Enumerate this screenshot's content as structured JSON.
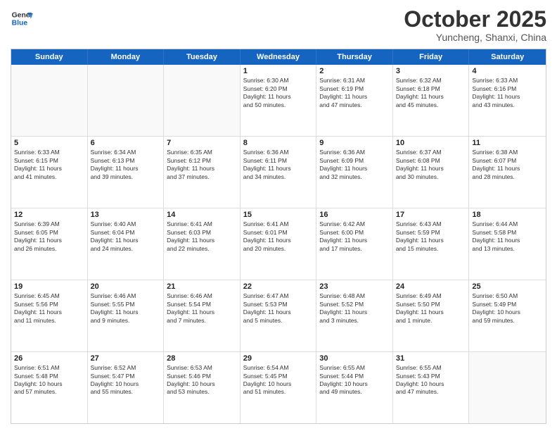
{
  "logo": {
    "line1": "General",
    "line2": "Blue"
  },
  "title": "October 2025",
  "subtitle": "Yuncheng, Shanxi, China",
  "weekdays": [
    "Sunday",
    "Monday",
    "Tuesday",
    "Wednesday",
    "Thursday",
    "Friday",
    "Saturday"
  ],
  "weeks": [
    [
      {
        "day": "",
        "info": ""
      },
      {
        "day": "",
        "info": ""
      },
      {
        "day": "",
        "info": ""
      },
      {
        "day": "1",
        "info": "Sunrise: 6:30 AM\nSunset: 6:20 PM\nDaylight: 11 hours\nand 50 minutes."
      },
      {
        "day": "2",
        "info": "Sunrise: 6:31 AM\nSunset: 6:19 PM\nDaylight: 11 hours\nand 47 minutes."
      },
      {
        "day": "3",
        "info": "Sunrise: 6:32 AM\nSunset: 6:18 PM\nDaylight: 11 hours\nand 45 minutes."
      },
      {
        "day": "4",
        "info": "Sunrise: 6:33 AM\nSunset: 6:16 PM\nDaylight: 11 hours\nand 43 minutes."
      }
    ],
    [
      {
        "day": "5",
        "info": "Sunrise: 6:33 AM\nSunset: 6:15 PM\nDaylight: 11 hours\nand 41 minutes."
      },
      {
        "day": "6",
        "info": "Sunrise: 6:34 AM\nSunset: 6:13 PM\nDaylight: 11 hours\nand 39 minutes."
      },
      {
        "day": "7",
        "info": "Sunrise: 6:35 AM\nSunset: 6:12 PM\nDaylight: 11 hours\nand 37 minutes."
      },
      {
        "day": "8",
        "info": "Sunrise: 6:36 AM\nSunset: 6:11 PM\nDaylight: 11 hours\nand 34 minutes."
      },
      {
        "day": "9",
        "info": "Sunrise: 6:36 AM\nSunset: 6:09 PM\nDaylight: 11 hours\nand 32 minutes."
      },
      {
        "day": "10",
        "info": "Sunrise: 6:37 AM\nSunset: 6:08 PM\nDaylight: 11 hours\nand 30 minutes."
      },
      {
        "day": "11",
        "info": "Sunrise: 6:38 AM\nSunset: 6:07 PM\nDaylight: 11 hours\nand 28 minutes."
      }
    ],
    [
      {
        "day": "12",
        "info": "Sunrise: 6:39 AM\nSunset: 6:05 PM\nDaylight: 11 hours\nand 26 minutes."
      },
      {
        "day": "13",
        "info": "Sunrise: 6:40 AM\nSunset: 6:04 PM\nDaylight: 11 hours\nand 24 minutes."
      },
      {
        "day": "14",
        "info": "Sunrise: 6:41 AM\nSunset: 6:03 PM\nDaylight: 11 hours\nand 22 minutes."
      },
      {
        "day": "15",
        "info": "Sunrise: 6:41 AM\nSunset: 6:01 PM\nDaylight: 11 hours\nand 20 minutes."
      },
      {
        "day": "16",
        "info": "Sunrise: 6:42 AM\nSunset: 6:00 PM\nDaylight: 11 hours\nand 17 minutes."
      },
      {
        "day": "17",
        "info": "Sunrise: 6:43 AM\nSunset: 5:59 PM\nDaylight: 11 hours\nand 15 minutes."
      },
      {
        "day": "18",
        "info": "Sunrise: 6:44 AM\nSunset: 5:58 PM\nDaylight: 11 hours\nand 13 minutes."
      }
    ],
    [
      {
        "day": "19",
        "info": "Sunrise: 6:45 AM\nSunset: 5:56 PM\nDaylight: 11 hours\nand 11 minutes."
      },
      {
        "day": "20",
        "info": "Sunrise: 6:46 AM\nSunset: 5:55 PM\nDaylight: 11 hours\nand 9 minutes."
      },
      {
        "day": "21",
        "info": "Sunrise: 6:46 AM\nSunset: 5:54 PM\nDaylight: 11 hours\nand 7 minutes."
      },
      {
        "day": "22",
        "info": "Sunrise: 6:47 AM\nSunset: 5:53 PM\nDaylight: 11 hours\nand 5 minutes."
      },
      {
        "day": "23",
        "info": "Sunrise: 6:48 AM\nSunset: 5:52 PM\nDaylight: 11 hours\nand 3 minutes."
      },
      {
        "day": "24",
        "info": "Sunrise: 6:49 AM\nSunset: 5:50 PM\nDaylight: 11 hours\nand 1 minute."
      },
      {
        "day": "25",
        "info": "Sunrise: 6:50 AM\nSunset: 5:49 PM\nDaylight: 10 hours\nand 59 minutes."
      }
    ],
    [
      {
        "day": "26",
        "info": "Sunrise: 6:51 AM\nSunset: 5:48 PM\nDaylight: 10 hours\nand 57 minutes."
      },
      {
        "day": "27",
        "info": "Sunrise: 6:52 AM\nSunset: 5:47 PM\nDaylight: 10 hours\nand 55 minutes."
      },
      {
        "day": "28",
        "info": "Sunrise: 6:53 AM\nSunset: 5:46 PM\nDaylight: 10 hours\nand 53 minutes."
      },
      {
        "day": "29",
        "info": "Sunrise: 6:54 AM\nSunset: 5:45 PM\nDaylight: 10 hours\nand 51 minutes."
      },
      {
        "day": "30",
        "info": "Sunrise: 6:55 AM\nSunset: 5:44 PM\nDaylight: 10 hours\nand 49 minutes."
      },
      {
        "day": "31",
        "info": "Sunrise: 6:55 AM\nSunset: 5:43 PM\nDaylight: 10 hours\nand 47 minutes."
      },
      {
        "day": "",
        "info": ""
      }
    ]
  ]
}
